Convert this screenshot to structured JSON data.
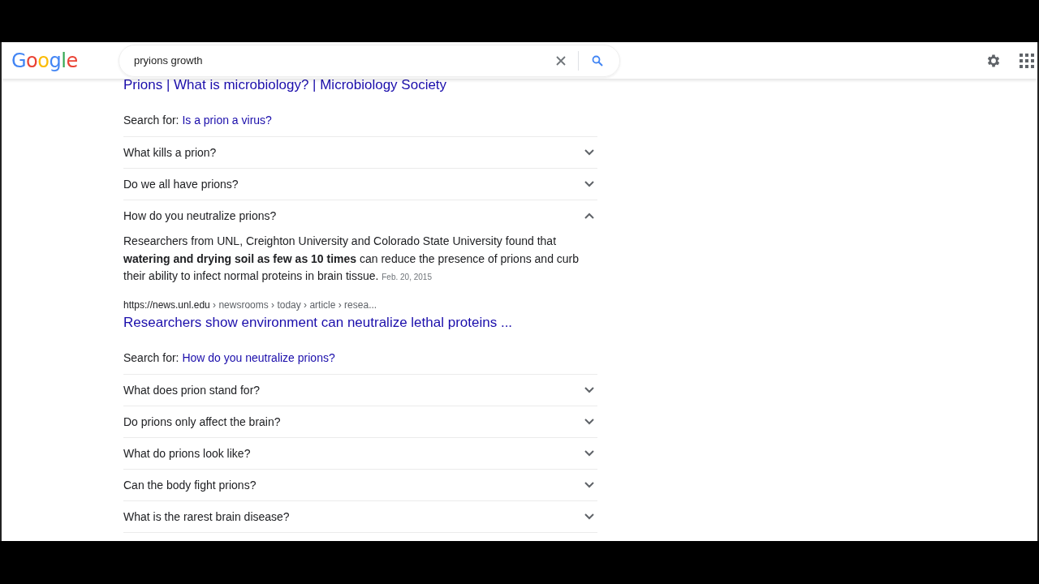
{
  "header": {
    "logo": "Google",
    "search": {
      "value": "pryions growth"
    }
  },
  "top_result": {
    "title": "Prions | What is microbiology? | Microbiology Society",
    "search_for_label": "Search for:",
    "search_for_link": "Is a prion a virus?"
  },
  "questions": [
    {
      "question": "What kills a prion?",
      "expanded": false
    },
    {
      "question": "Do we all have prions?",
      "expanded": false
    },
    {
      "question": "How do you neutralize prions?",
      "expanded": true,
      "answer": "Researchers from UNL, Creighton University and Colorado State University found that **watering and drying soil as few as 10 times** can reduce the presence of prions and curb their ability to infect normal proteins in brain tissue.",
      "date": "Feb. 20, 2015",
      "url": "https://news.unl.edu",
      "breadcrumb": "› newsrooms › today › article › resea...",
      "title": "Researchers show environment can neutralize lethal proteins ...",
      "search_for_label": "Search for:",
      "search_for_link": "How do you neutralize prions?"
    },
    {
      "question": "What does prion stand for?",
      "expanded": false
    },
    {
      "question": "Do prions only affect the brain?",
      "expanded": false
    },
    {
      "question": "What do prions look like?",
      "expanded": false
    },
    {
      "question": "Can the body fight prions?",
      "expanded": false
    },
    {
      "question": "What is the rarest brain disease?",
      "expanded": false
    }
  ]
}
